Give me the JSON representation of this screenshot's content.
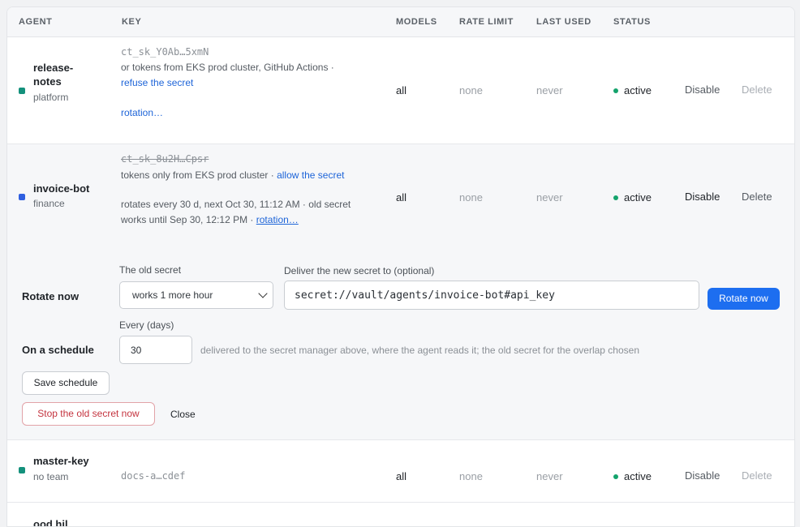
{
  "headers": {
    "agent": "AGENT",
    "key": "KEY",
    "models": "MODELS",
    "rate_limit": "RATE LIMIT",
    "last_used": "LAST USED",
    "status": "STATUS"
  },
  "rows": [
    {
      "name_line1": "release-",
      "name_line2": "notes",
      "team": "platform",
      "dot_color": "#14917c",
      "key": "ct_sk_Y0Ab…5xmN",
      "policy": "or tokens from EKS prod cluster, GitHub Actions ·",
      "policy_link": "refuse the secret",
      "rotation_link": "rotation…",
      "models": "all",
      "rate_limit": "none",
      "last_used": "never",
      "status": "active",
      "disable": "Disable",
      "delete": "Delete"
    },
    {
      "name": "invoice-bot",
      "team": "finance",
      "dot_color": "#2f5fe0",
      "key": "ct_sk_8u2H…Cpsr",
      "policy": "tokens only from EKS prod cluster ·",
      "policy_link": "allow the secret",
      "rotation_line1": "rotates every 30 d, next Oct 30, 11:12 AM · old secret",
      "rotation_line2": "works until Sep 30, 12:12 PM ·",
      "rotation_link": "rotation…",
      "models": "all",
      "rate_limit": "none",
      "last_used": "never",
      "status": "active",
      "disable": "Disable",
      "delete": "Delete"
    },
    {
      "name": "master-key",
      "team": "no team",
      "dot_color": "#14917c",
      "key": "docs-a…cdef",
      "models": "all",
      "rate_limit": "none",
      "last_used": "never",
      "status": "active",
      "disable": "Disable",
      "delete": "Delete"
    }
  ],
  "rotate_panel": {
    "rotate_now_label": "Rotate now",
    "old_secret_label": "The old secret",
    "old_secret_value": "works 1 more hour",
    "deliver_label": "Deliver the new secret to (optional)",
    "deliver_value": "secret://vault/agents/invoice-bot#api_key",
    "rotate_button": "Rotate now",
    "schedule_label": "On a schedule",
    "every_label": "Every (days)",
    "every_value": "30",
    "schedule_hint": "delivered to the secret manager above, where the agent reads it; the old secret for the overlap chosen",
    "save_schedule": "Save schedule",
    "stop_old": "Stop the old secret now",
    "close": "Close"
  },
  "partial_row": {
    "name_fragment": "ood hil"
  }
}
